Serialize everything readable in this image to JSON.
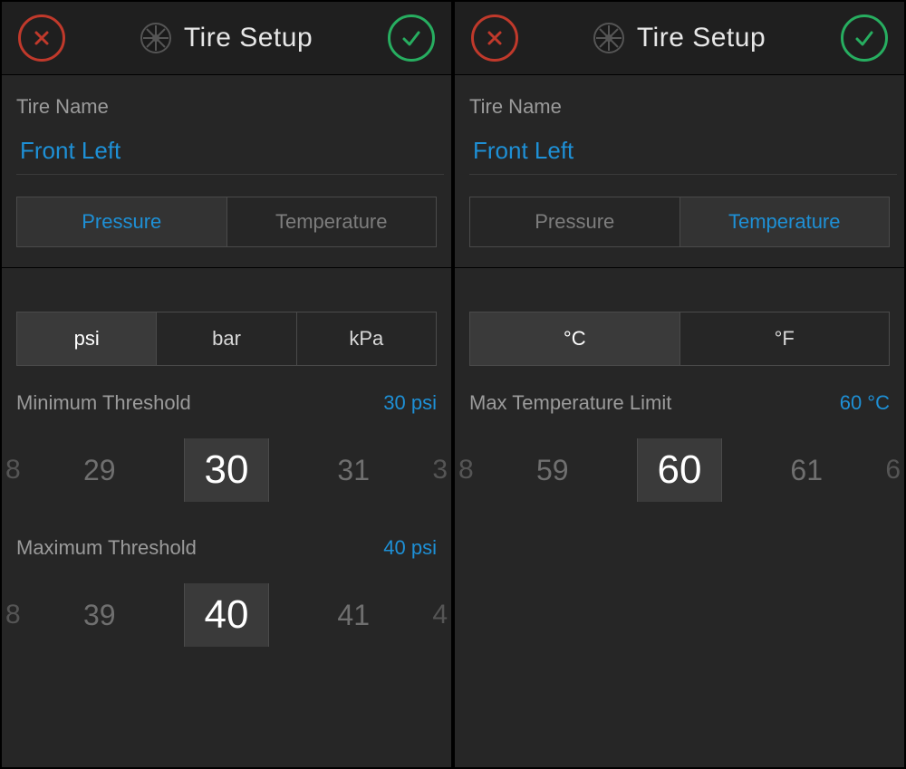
{
  "left": {
    "title": "Tire Setup",
    "name_label": "Tire Name",
    "name_value": "Front Left",
    "tabs": {
      "pressure": "Pressure",
      "temperature": "Temperature",
      "active": "pressure"
    },
    "units": {
      "options": [
        "psi",
        "bar",
        "kPa"
      ],
      "active": 0
    },
    "min": {
      "label": "Minimum Threshold",
      "value_text": "30 psi",
      "picker": {
        "edge_lo": "8",
        "lo": "29",
        "center": "30",
        "hi": "31",
        "edge_hi": "3"
      }
    },
    "max": {
      "label": "Maximum Threshold",
      "value_text": "40 psi",
      "picker": {
        "edge_lo": "8",
        "lo": "39",
        "center": "40",
        "hi": "41",
        "edge_hi": "4"
      }
    }
  },
  "right": {
    "title": "Tire Setup",
    "name_label": "Tire Name",
    "name_value": "Front Left",
    "tabs": {
      "pressure": "Pressure",
      "temperature": "Temperature",
      "active": "temperature"
    },
    "units": {
      "options": [
        "°C",
        "°F"
      ],
      "active": 0
    },
    "limit": {
      "label": "Max Temperature Limit",
      "value_text": "60 °C",
      "picker": {
        "edge_lo": "8",
        "lo": "59",
        "center": "60",
        "hi": "61",
        "edge_hi": "6"
      }
    }
  }
}
